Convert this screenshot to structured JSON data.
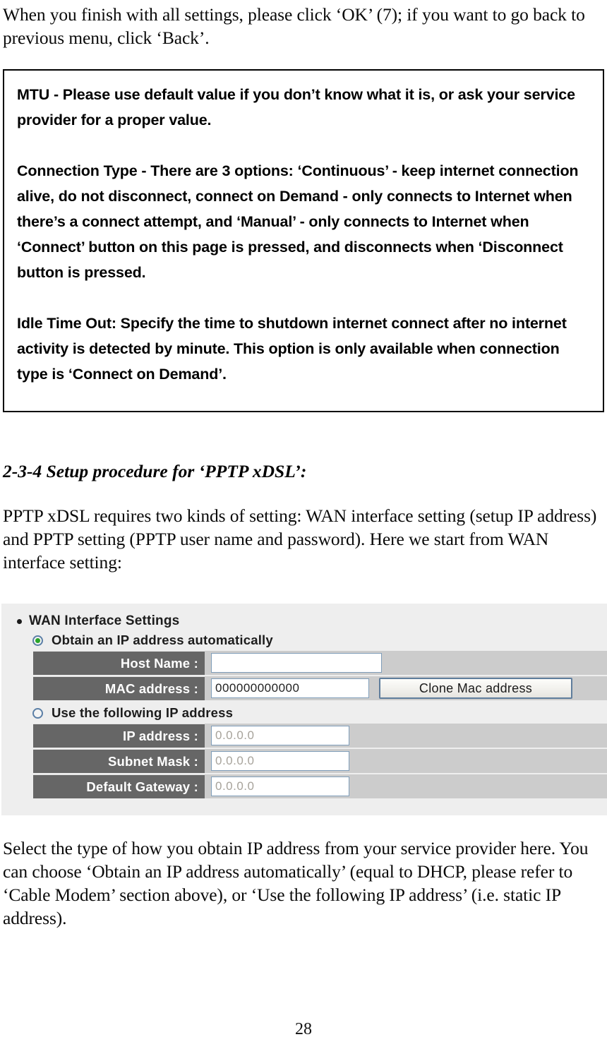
{
  "intro": {
    "paragraph": "When you finish with all settings, please click ‘OK’ (7); if you want to go back to previous menu, click ‘Back’."
  },
  "note_box": {
    "mtu": "MTU - Please use default value if you don’t know what it is, or ask your service provider for a proper value.",
    "connection_type": "Connection Type - There are 3 options: ‘Continuous’ - keep internet connection alive, do not disconnect, connect on Demand - only connects to Internet when there’s a connect attempt, and ‘Manual’ - only connects to Internet when ‘Connect’ button on this page is pressed, and disconnects when ‘Disconnect button is pressed.",
    "idle_time_out": "Idle Time Out: Specify the time to shutdown internet connect after no internet activity is detected by minute. This option is only available when connection type is ‘Connect on Demand’."
  },
  "section": {
    "heading": "2-3-4 Setup procedure for ‘PPTP xDSL’:",
    "paragraph": "PPTP xDSL requires two kinds of setting: WAN interface setting (setup IP address) and PPTP setting (PPTP user name and password). Here we start from WAN interface setting:"
  },
  "router_ui": {
    "group_title": "WAN Interface Settings",
    "radio_auto": {
      "label": "Obtain an IP address automatically",
      "selected": true
    },
    "radio_static": {
      "label": "Use the following IP address",
      "selected": false
    },
    "fields": {
      "host_name": {
        "label": "Host Name :",
        "value": "",
        "placeholder": ""
      },
      "mac_address": {
        "label": "MAC address :",
        "value": "000000000000"
      },
      "ip_address": {
        "label": "IP address :",
        "value": "0.0.0.0"
      },
      "subnet_mask": {
        "label": "Subnet Mask :",
        "value": "0.0.0.0"
      },
      "default_gateway": {
        "label": "Default Gateway :",
        "value": "0.0.0.0"
      }
    },
    "clone_button": "Clone Mac address",
    "colors": {
      "panel_bg": "#eeeeee",
      "row_bg": "#cccccc",
      "label_bg": "#666666",
      "input_border": "#7f9db9",
      "radio_selected_dot": "#2aa52a"
    }
  },
  "closing": {
    "paragraph": "Select the type of how you obtain IP address from your service provider here. You can choose ‘Obtain an IP address automatically’ (equal to DHCP, please refer to ‘Cable Modem’ section above), or ‘Use the following IP address’ (i.e. static IP address)."
  },
  "footer": {
    "page_number": "28"
  }
}
